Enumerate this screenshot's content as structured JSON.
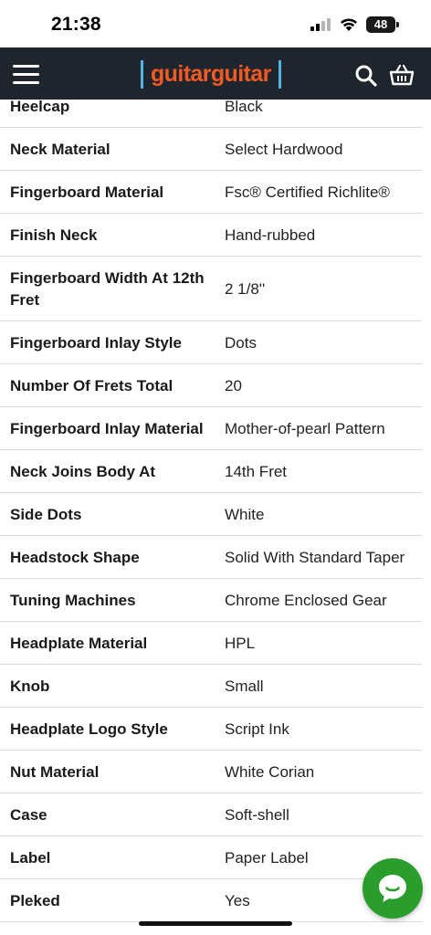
{
  "status_bar": {
    "time": "21:38",
    "battery": "48"
  },
  "header": {
    "logo_text": "guitarguitar"
  },
  "specs": [
    {
      "label": "Heelcap",
      "value": "Black"
    },
    {
      "label": "Neck Material",
      "value": "Select Hardwood"
    },
    {
      "label": "Fingerboard Material",
      "value": "Fsc® Certified Richlite®"
    },
    {
      "label": "Finish Neck",
      "value": "Hand-rubbed"
    },
    {
      "label": "Fingerboard Width At 12th Fret",
      "value": "2 1/8''"
    },
    {
      "label": "Fingerboard Inlay Style",
      "value": "Dots"
    },
    {
      "label": "Number Of Frets Total",
      "value": "20"
    },
    {
      "label": "Fingerboard Inlay Material",
      "value": "Mother-of-pearl Pattern"
    },
    {
      "label": "Neck Joins Body At",
      "value": "14th Fret"
    },
    {
      "label": "Side Dots",
      "value": "White"
    },
    {
      "label": "Headstock Shape",
      "value": "Solid With Standard Taper"
    },
    {
      "label": "Tuning Machines",
      "value": "Chrome Enclosed Gear"
    },
    {
      "label": "Headplate Material",
      "value": "HPL"
    },
    {
      "label": "Knob",
      "value": "Small"
    },
    {
      "label": "Headplate Logo Style",
      "value": "Script Ink"
    },
    {
      "label": "Nut Material",
      "value": "White Corian"
    },
    {
      "label": "Case",
      "value": "Soft-shell"
    },
    {
      "label": "Label",
      "value": "Paper Label"
    },
    {
      "label": "Pleked",
      "value": "Yes"
    }
  ],
  "colors": {
    "header_bg": "#1f252c",
    "logo_orange": "#f15a22",
    "logo_blue": "#4fb3e6",
    "chat_green": "#2a9d2c"
  },
  "icons": {
    "menu": "hamburger-icon",
    "search": "search-icon",
    "basket": "basket-icon",
    "chat": "chat-icon"
  }
}
